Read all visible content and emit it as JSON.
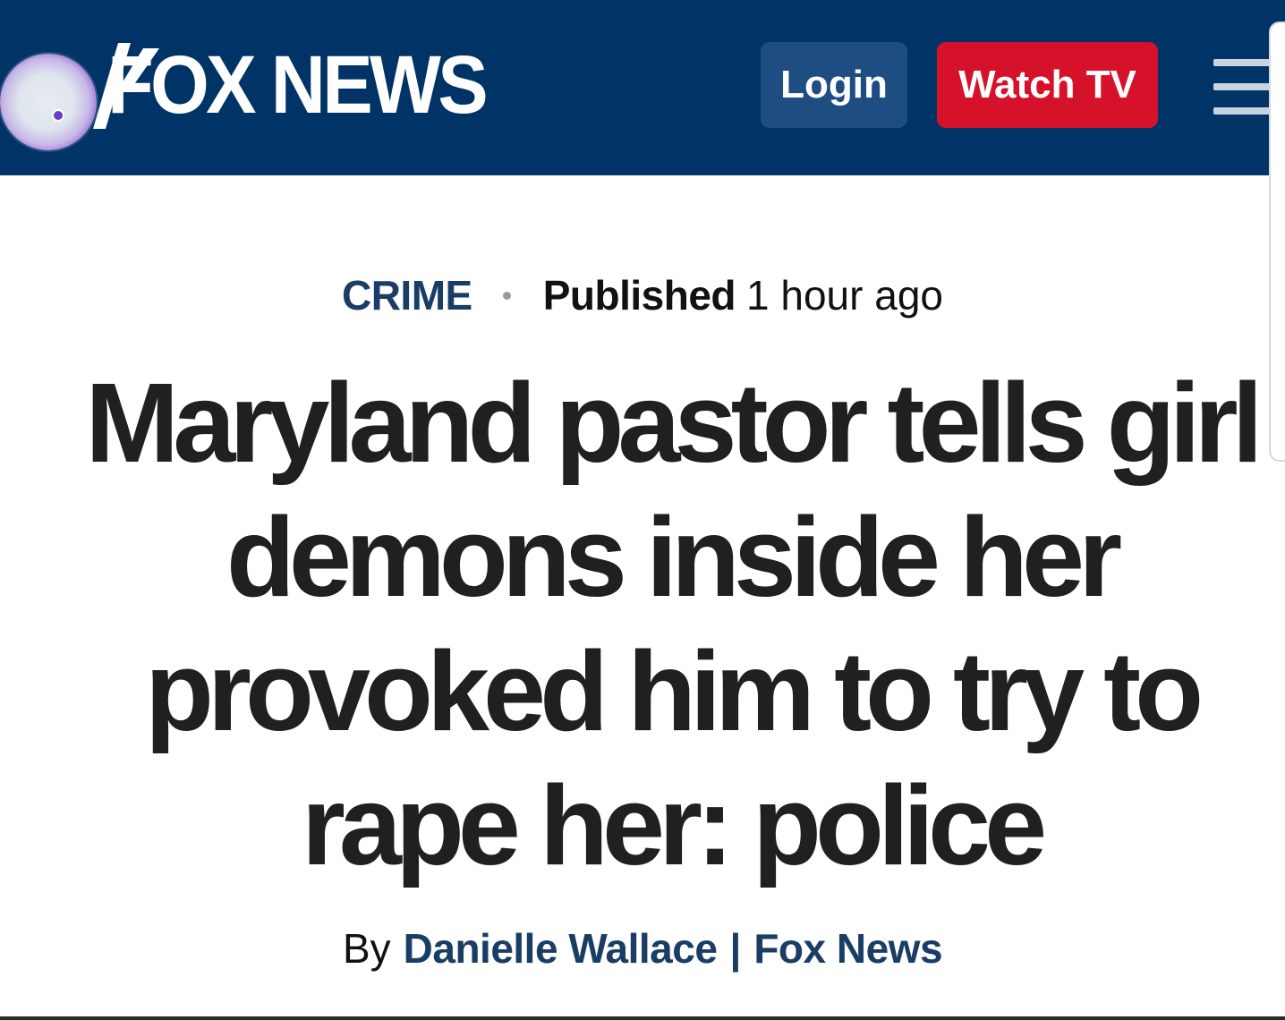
{
  "header": {
    "brand": "FOX NEWS",
    "login_label": "Login",
    "watch_label": "Watch TV",
    "background_color": "#003366",
    "watch_color": "#d6122b",
    "login_color": "#1e4d82"
  },
  "article": {
    "category": "CRIME",
    "published_label": "Published",
    "published_time": "1 hour ago",
    "headline_lines": [
      "Maryland pastor tells girl",
      "demons inside her",
      "provoked him to try to",
      "rape her: police"
    ],
    "byline": {
      "prefix": "By",
      "author": "Danielle Wallace",
      "separator": "|",
      "source": "Fox News"
    }
  },
  "icons": {
    "menu": "hamburger-menu-icon",
    "assistant": "assistant-bubble-icon"
  }
}
